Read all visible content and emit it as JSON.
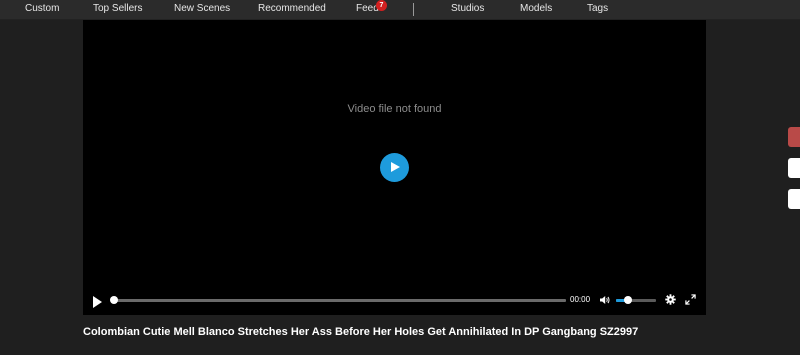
{
  "nav": {
    "items": [
      {
        "label": "Custom"
      },
      {
        "label": "Top Sellers"
      },
      {
        "label": "New Scenes"
      },
      {
        "label": "Recommended"
      },
      {
        "label": "Feed",
        "badge": "7"
      },
      {
        "label": "Studios"
      },
      {
        "label": "Models"
      },
      {
        "label": "Tags"
      }
    ]
  },
  "player": {
    "message": "Video file not found",
    "current_time": "00:00",
    "progress_fraction": 0,
    "volume_fraction": 0.3,
    "accent_color": "#1e9bdc"
  },
  "video": {
    "title": "Colombian Cutie Mell Blanco Stretches Her Ass Before Her Holes Get Annihilated In DP Gangbang SZ2997"
  },
  "side_buttons": [
    {
      "color": "#b94a48"
    },
    {
      "color": "#ffffff"
    },
    {
      "color": "#ffffff"
    }
  ]
}
